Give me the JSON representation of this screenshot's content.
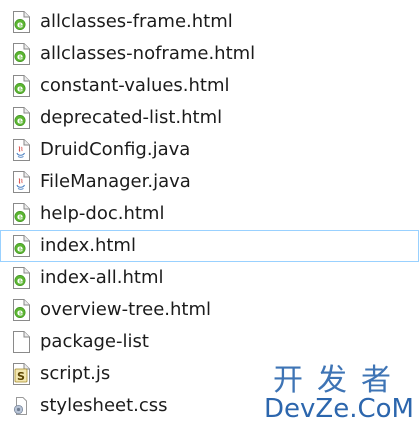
{
  "files": [
    {
      "name": "allclasses-frame.html",
      "icon": "html-file-icon"
    },
    {
      "name": "allclasses-noframe.html",
      "icon": "html-file-icon"
    },
    {
      "name": "constant-values.html",
      "icon": "html-file-icon"
    },
    {
      "name": "deprecated-list.html",
      "icon": "html-file-icon"
    },
    {
      "name": "DruidConfig.java",
      "icon": "java-file-icon"
    },
    {
      "name": "FileManager.java",
      "icon": "java-file-icon"
    },
    {
      "name": "help-doc.html",
      "icon": "html-file-icon"
    },
    {
      "name": "index.html",
      "icon": "html-file-icon",
      "selected": true
    },
    {
      "name": "index-all.html",
      "icon": "html-file-icon"
    },
    {
      "name": "overview-tree.html",
      "icon": "html-file-icon"
    },
    {
      "name": "package-list",
      "icon": "blank-file-icon"
    },
    {
      "name": "script.js",
      "icon": "js-file-icon"
    },
    {
      "name": "stylesheet.css",
      "icon": "css-file-icon"
    }
  ],
  "watermark": {
    "line1": "开发者",
    "line2": "DevZe.CoM"
  },
  "colors": {
    "selection_border": "#99d1ff",
    "text": "#1b1b1b",
    "watermark": "#3e74b5"
  }
}
